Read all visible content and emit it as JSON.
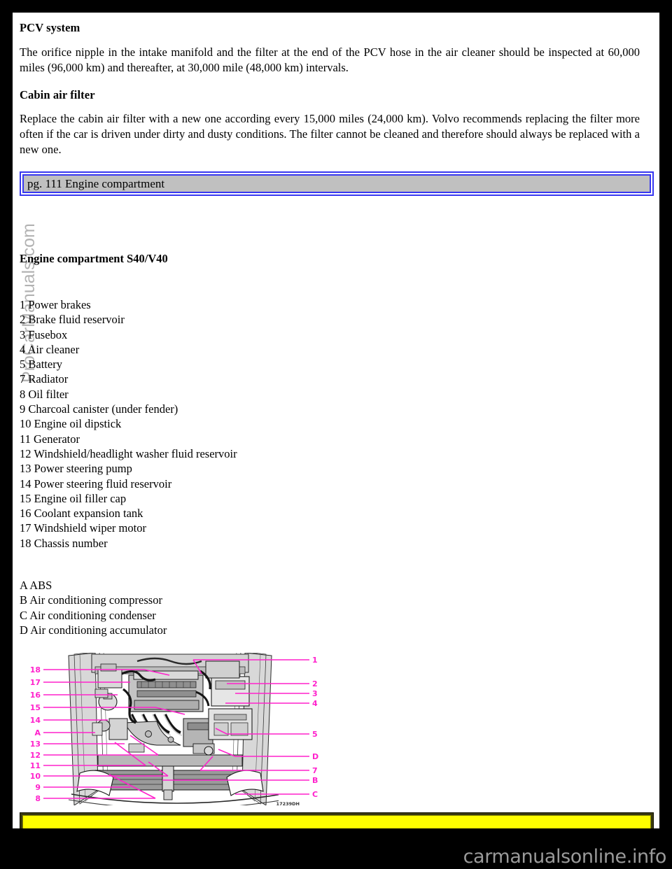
{
  "page": {
    "background_color": "#000000",
    "sheet_color": "#ffffff"
  },
  "sections": [
    {
      "heading": "PCV system",
      "paragraph": "The orifice nipple in the intake manifold and the filter at the end of the PCV hose in the air cleaner should be inspected at 60,000 miles (96,000 km) and thereafter, at 30,000 mile (48,000 km) intervals."
    },
    {
      "heading": "Cabin air filter",
      "paragraph": "Replace the cabin air filter with a new one according every 15,000 miles (24,000 km). Volvo recommends replacing the filter more often if the car is driven under dirty and dusty conditions. The filter cannot be cleaned and therefore should always be replaced with a new one."
    }
  ],
  "page_bar": {
    "label": "pg. 111 Engine compartment",
    "border_color": "#3838f0",
    "fill_color": "#c0c0c0"
  },
  "engine_compartment": {
    "heading": "Engine compartment S40/V40",
    "numbered_items": [
      "1 Power brakes",
      "2 Brake fluid reservoir",
      "3 Fusebox",
      "4 Air cleaner",
      "5 Battery",
      "7 Radiator",
      "8 Oil filter",
      "9 Charcoal canister (under fender)",
      "10 Engine oil dipstick",
      "11 Generator",
      "12 Windshield/headlight washer fluid reservoir",
      "13 Power steering pump",
      "14 Power steering fluid reservoir",
      "15 Engine oil filler cap",
      "16 Coolant expansion tank",
      "17 Windshield wiper motor",
      "18 Chassis number"
    ],
    "lettered_items": [
      "A ABS",
      "B Air conditioning compressor",
      "C Air conditioning condenser",
      "D Air conditioning accumulator"
    ]
  },
  "watermark": {
    "text": "ProCarManuals.com",
    "color": "rgba(0,0,0,0.30)"
  },
  "diagram": {
    "name": "engine-compartment-diagram",
    "callout_color": "#ff22cc",
    "image_code": "17239DH",
    "left_callouts": [
      "18",
      "17",
      "16",
      "15",
      "14",
      "A",
      "13",
      "12",
      "11",
      "10",
      "9",
      "8"
    ],
    "right_callouts": [
      "1",
      "2",
      "3",
      "4",
      "5",
      "D",
      "7",
      "B",
      "C"
    ]
  },
  "notice_bar": {
    "fill_color": "#ffff00",
    "text": ""
  },
  "brand": {
    "text": "carmanualsonline.info",
    "color": "#9a9a9a"
  }
}
